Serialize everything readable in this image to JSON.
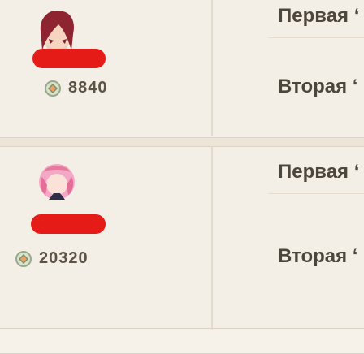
{
  "rows": [
    {
      "score": "8840",
      "tier": "Первая ‘"
    },
    {
      "tier": "Вторая ‘"
    },
    {
      "score": "20320",
      "tier": "Первая ‘"
    },
    {
      "tier": "Вторая ‘"
    }
  ],
  "colors": {
    "accent_red": "#e41b17",
    "text": "#5b5345",
    "panel": "#f4efe6"
  }
}
